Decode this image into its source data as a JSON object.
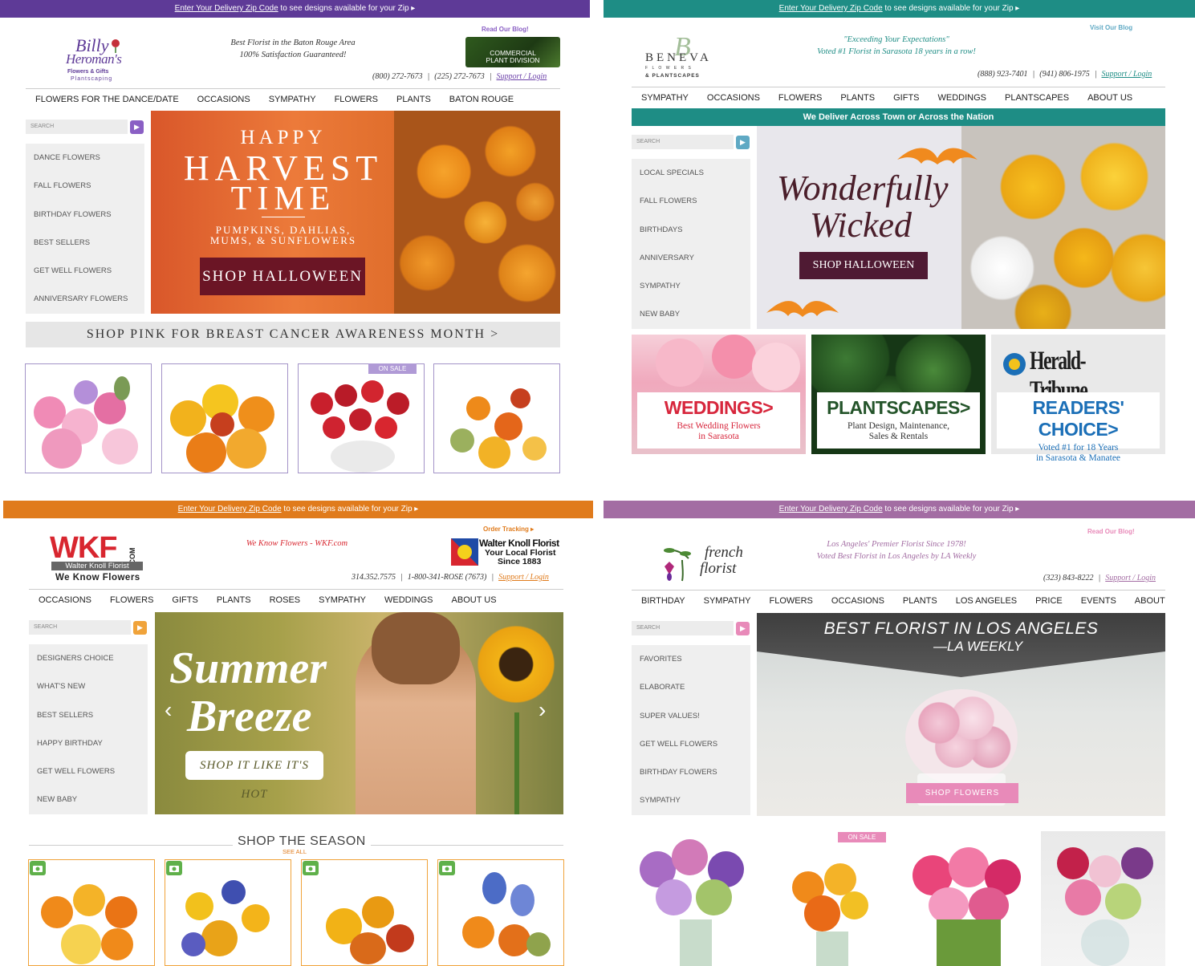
{
  "colors": {
    "billy_purple": "#5e3a97",
    "beneva_teal": "#1e8d85",
    "wkf_orange": "#e07b1c",
    "french_mauve": "#a36da3",
    "maroon": "#6b1525",
    "pink_btn": "#e88ab9"
  },
  "billy": {
    "bar_link": "Enter Your Delivery Zip Code",
    "bar_text": " to see designs available for your Zip ▸",
    "logo_line1": "Billy",
    "logo_line2": "Heroman's",
    "logo_sub1": "Flowers & Gifts",
    "logo_sub2": "Plantscaping",
    "tagline1": "Best Florist in the Baton Rouge Area",
    "tagline2": "100% Satisfaction Guaranteed!",
    "blog": "Read Our Blog!",
    "commercial1": "COMMERCIAL",
    "commercial2": "PLANT DIVISION",
    "phone1": "(800) 272-7673",
    "phone2": "(225) 272-7673",
    "support": "Support / Login",
    "nav": [
      "FLOWERS FOR THE DANCE/DATE",
      "OCCASIONS",
      "SYMPATHY",
      "FLOWERS",
      "PLANTS",
      "BATON ROUGE"
    ],
    "search_placeholder": "SEARCH",
    "side": [
      "DANCE FLOWERS",
      "FALL FLOWERS",
      "BIRTHDAY FLOWERS",
      "BEST SELLERS",
      "GET WELL FLOWERS",
      "ANNIVERSARY FLOWERS"
    ],
    "hero_line1": "HAPPY",
    "hero_line2": "HARVEST",
    "hero_line3": "TIME",
    "hero_sub1": "PUMPKINS, DAHLIAS,",
    "hero_sub2": "MUMS, & SUNFLOWERS",
    "hero_btn": "SHOP HALLOWEEN",
    "pink_banner": "SHOP PINK FOR BREAST CANCER AWARENESS MONTH >",
    "sale": "ON SALE"
  },
  "beneva": {
    "bar_link": "Enter Your Delivery Zip Code",
    "bar_text": " to see designs available for your Zip ▸",
    "logo_name": "BENEVA",
    "logo_sub1": "F L O W E R S",
    "logo_sub2": "& PLANTSCAPES",
    "tagline1": "\"Exceeding Your Expectations\"",
    "tagline2": "Voted #1 Florist in Sarasota 18 years in a row!",
    "blog": "Visit Our Blog",
    "phone1": "(888) 923-7401",
    "phone2": "(941) 806-1975",
    "support": "Support / Login",
    "nav": [
      "SYMPATHY",
      "OCCASIONS",
      "FLOWERS",
      "PLANTS",
      "GIFTS",
      "WEDDINGS",
      "PLANTSCAPES",
      "ABOUT US"
    ],
    "deliver": "We Deliver Across Town or Across the Nation",
    "search_placeholder": "SEARCH",
    "side": [
      "LOCAL SPECIALS",
      "FALL FLOWERS",
      "BIRTHDAYS",
      "ANNIVERSARY",
      "SYMPATHY",
      "NEW BABY"
    ],
    "hero_line1": "Wonderfully",
    "hero_line2": "Wicked",
    "hero_btn": "SHOP HALLOWEEN",
    "tiles": [
      {
        "title": "WEDDINGS>",
        "line1": "Best Wedding Flowers",
        "line2": "in Sarasota"
      },
      {
        "title": "PLANTSCAPES>",
        "line1": "Plant Design, Maintenance,",
        "line2": "Sales & Rentals"
      },
      {
        "title": "READERS' CHOICE>",
        "line1": "Voted #1 for 18 Years",
        "line2": "in Sarasota & Manatee"
      }
    ],
    "herald": "Herald-Tribune"
  },
  "wkf": {
    "bar_link": "Enter Your Delivery Zip Code",
    "bar_text": " to see designs available for your Zip ▸",
    "logo_main": "WKF",
    "logo_com": ".COM",
    "logo_sub": "Walter Knoll Florist",
    "logo_slogan": "We Know Flowers",
    "tagline": "We Know Flowers - WKF.com",
    "tracking": "Order Tracking ▸",
    "badge1": "Walter Knoll Florist",
    "badge2": "Your Local Florist",
    "badge3": "Since 1883",
    "phone1": "314.352.7575",
    "phone2": "1-800-341-ROSE (7673)",
    "support": "Support / Login",
    "nav": [
      "OCCASIONS",
      "FLOWERS",
      "GIFTS",
      "PLANTS",
      "ROSES",
      "SYMPATHY",
      "WEDDINGS",
      "ABOUT US"
    ],
    "search_placeholder": "SEARCH",
    "side": [
      "DESIGNERS CHOICE",
      "WHAT'S NEW",
      "BEST SELLERS",
      "HAPPY BIRTHDAY",
      "GET WELL FLOWERS",
      "NEW BABY"
    ],
    "hero_line1": "Summer",
    "hero_line2": "Breeze",
    "hero_btn": "SHOP IT LIKE IT'S HOT",
    "shop_season": "SHOP THE SEASON",
    "see_all": "SEE ALL"
  },
  "french": {
    "bar_link": "Enter Your Delivery Zip Code",
    "bar_text": " to see designs available for your Zip ▸",
    "logo1": "french",
    "logo2": "florist",
    "tagline1": "Los Angeles' Premier Florist Since 1978!",
    "tagline2": "Voted Best Florist in Los Angeles by LA Weekly",
    "blog": "Read Our Blog!",
    "phone": "(323) 843-8222",
    "support": "Support / Login",
    "nav": [
      "BIRTHDAY",
      "SYMPATHY",
      "FLOWERS",
      "OCCASIONS",
      "PLANTS",
      "LOS ANGELES",
      "PRICE",
      "EVENTS",
      "ABOUT"
    ],
    "search_placeholder": "SEARCH",
    "side": [
      "FAVORITES",
      "ELABORATE",
      "SUPER VALUES!",
      "GET WELL FLOWERS",
      "BIRTHDAY FLOWERS",
      "SYMPATHY"
    ],
    "hero_line1": "BEST FLORIST IN LOS ANGELES",
    "hero_line2": "—LA WEEKLY",
    "hero_btn": "SHOP FLOWERS",
    "sale": "ON SALE"
  }
}
